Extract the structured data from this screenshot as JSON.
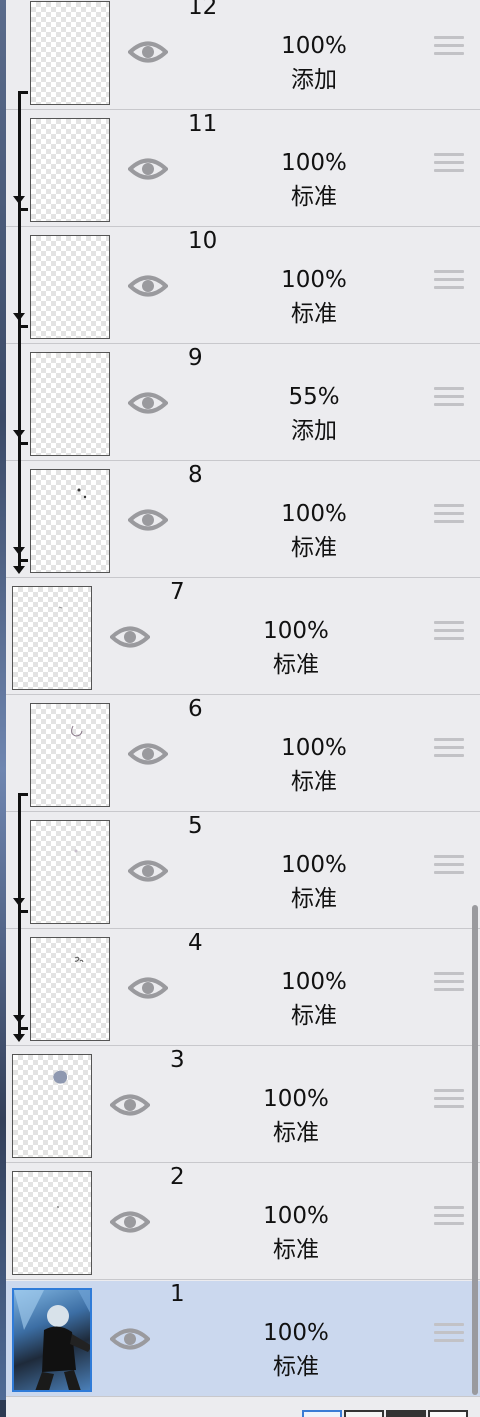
{
  "layers": [
    {
      "name": "12",
      "opacity": "100%",
      "blend": "添加"
    },
    {
      "name": "11",
      "opacity": "100%",
      "blend": "标准"
    },
    {
      "name": "10",
      "opacity": "100%",
      "blend": "标准"
    },
    {
      "name": "9",
      "opacity": "55%",
      "blend": "添加"
    },
    {
      "name": "8",
      "opacity": "100%",
      "blend": "标准"
    },
    {
      "name": "7",
      "opacity": "100%",
      "blend": "标准"
    },
    {
      "name": "6",
      "opacity": "100%",
      "blend": "标准"
    },
    {
      "name": "5",
      "opacity": "100%",
      "blend": "标准"
    },
    {
      "name": "4",
      "opacity": "100%",
      "blend": "标准"
    },
    {
      "name": "3",
      "opacity": "100%",
      "blend": "标准"
    },
    {
      "name": "2",
      "opacity": "100%",
      "blend": "标准"
    },
    {
      "name": "1",
      "opacity": "100%",
      "blend": "标准"
    }
  ],
  "selected_layer": "1",
  "colors": {
    "panel_bg": "#ececef",
    "selected_bg": "#cbd8ee",
    "selected_border": "#2f7bd8",
    "eye_icon": "#9a9a9e",
    "clip_indicator": "#111111"
  },
  "icons": {
    "visibility": "eye-icon",
    "reorder": "drag-handle-icon",
    "clipping": "clipping-arrow-icon"
  }
}
